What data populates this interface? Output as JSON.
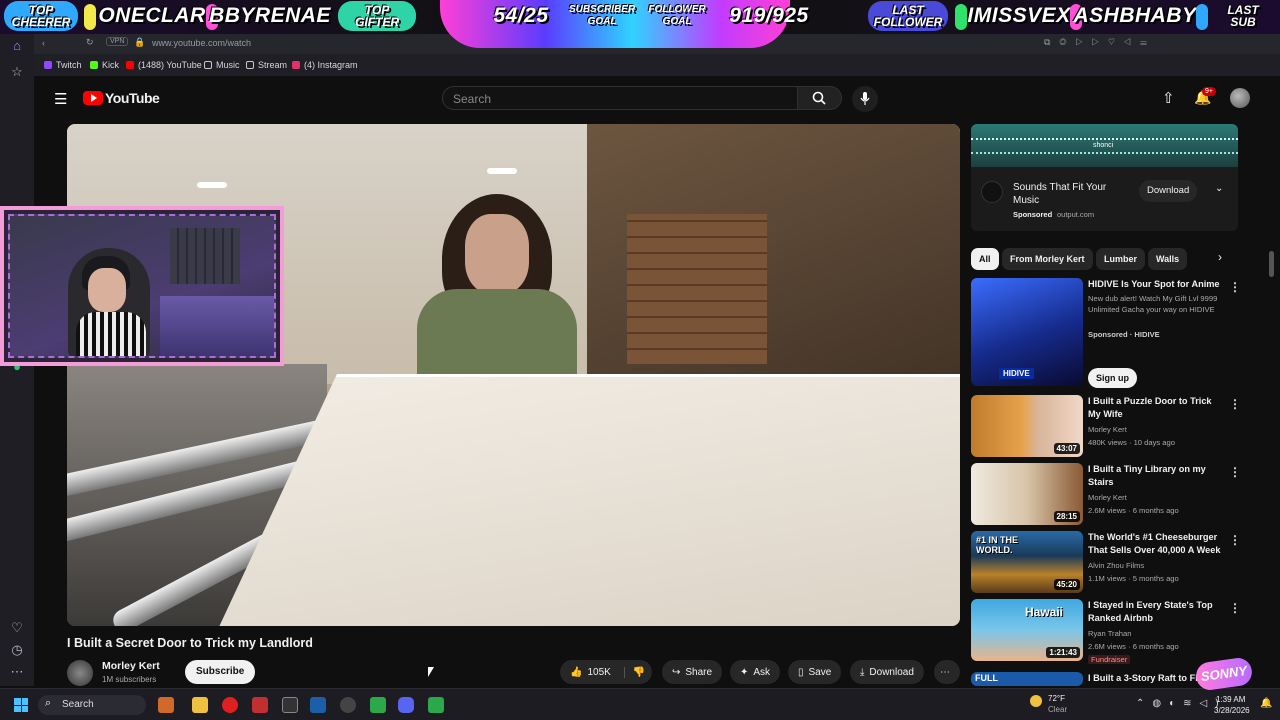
{
  "overlay": {
    "top_cheerer_label": "TOP\nCHEERER",
    "top_cheerer_name": "ONECLAR",
    "top_gifter_name": "BBYRENAE",
    "top_gifter_label": "TOP\nGIFTER",
    "subscriber_goal_value": "54/25",
    "subscriber_goal_label": "SUBSCRIBER\nGOAL",
    "follower_goal_label": "FOLLOWER\nGOAL",
    "follower_goal_value": "919/925",
    "last_follower_label": "LAST\nFOLLOWER",
    "last_follower_name": "IMISSVEX",
    "last_sub_name": "ASHBHABY",
    "last_sub_label": "LAST\nSUB",
    "watermark": "SONNY"
  },
  "browser": {
    "url": "www.youtube.com/watch",
    "vpn_label": "VPN",
    "bookmarks": [
      {
        "label": "Twitch",
        "color": "#9146ff"
      },
      {
        "label": "Kick",
        "color": "#53fc18"
      },
      {
        "label": "(1488) YouTube",
        "color": "#ff0000"
      },
      {
        "label": "Music",
        "color": "#c8c8c8"
      },
      {
        "label": "Stream",
        "color": "#c8c8c8"
      },
      {
        "label": "(4) Instagram",
        "color": "#e1306c"
      }
    ]
  },
  "youtube": {
    "logo_text": "YouTube",
    "search_placeholder": "Search",
    "notifications_badge": "9+",
    "video_title": "I Built a Secret Door to Trick my Landlord",
    "channel_name": "Morley Kert",
    "subscriber_count": "1M subscribers",
    "subscribe_label": "Subscribe",
    "like_count": "105K",
    "share_label": "Share",
    "ask_label": "Ask",
    "save_label": "Save",
    "download_label": "Download",
    "ad": {
      "banner_text": "shonci",
      "title": "Sounds That Fit Your Music",
      "sponsored": "Sponsored",
      "domain": "output.com",
      "download_label": "Download"
    },
    "chips": [
      "All",
      "From Morley Kert",
      "Lumber",
      "Walls"
    ],
    "recommendations": [
      {
        "title": "HIDIVE Is Your Spot for Anime",
        "desc": "New dub alert! Watch My Gift Lvl 9999 Unlimited Gacha your way on HIDIVE",
        "channel": "Sponsored · HIDIVE",
        "meta": "",
        "duration": "",
        "action": "Sign up",
        "thumb_text": "HIDIVE"
      },
      {
        "title": "I Built a Puzzle Door to Trick My Wife",
        "channel": "Morley Kert",
        "meta": "480K views · 10 days ago",
        "duration": "43:07",
        "thumb_text": ""
      },
      {
        "title": "I Built a Tiny Library on my Stairs",
        "channel": "Morley Kert",
        "meta": "2.6M views · 6 months ago",
        "duration": "28:15",
        "thumb_text": ""
      },
      {
        "title": "The World's #1 Cheeseburger That Sells Over 40,000 A Week",
        "channel": "Alvin Zhou Films",
        "meta": "1.1M views · 5 months ago",
        "duration": "45:20",
        "thumb_text": "#1 IN THE WORLD."
      },
      {
        "title": "I Stayed in Every State's Top Ranked Airbnb",
        "channel": "Ryan Trahan",
        "meta": "2.6M views · 6 months ago",
        "duration": "1:21:43",
        "badge": "Fundraiser",
        "thumb_text": "Hawaii"
      },
      {
        "title": "I Built a 3-Story Raft to Flo",
        "channel": "",
        "meta": "",
        "duration": "",
        "thumb_text": "FULL"
      }
    ]
  },
  "taskbar": {
    "search_label": "Search",
    "weather_temp": "72°F",
    "weather_desc": "Clear",
    "time": "1:39 AM",
    "date": "3/28/2026"
  }
}
